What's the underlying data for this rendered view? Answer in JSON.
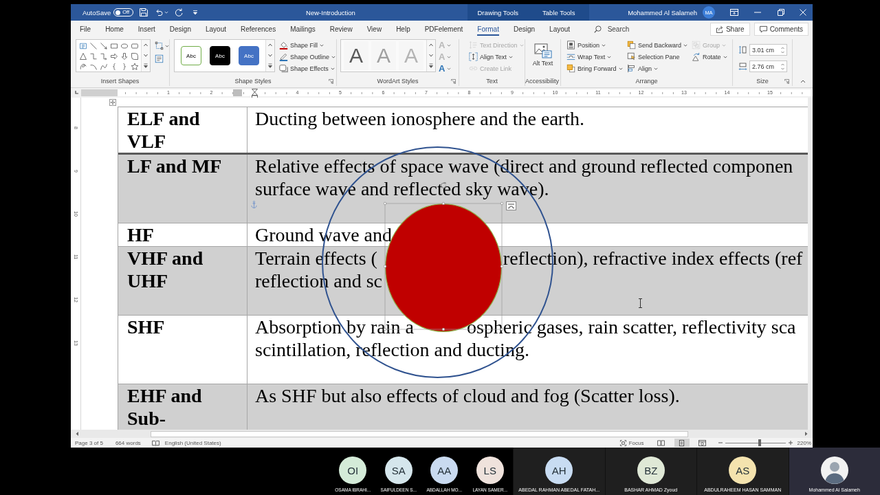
{
  "window": {
    "title": "New-Introduction",
    "autosave": {
      "label": "AutoSave",
      "state": "Off",
      "on": false
    },
    "context_groups": [
      {
        "label": "Drawing Tools"
      },
      {
        "label": "Table Tools"
      }
    ],
    "account": {
      "name": "Mohammed Al Salameh",
      "initials": "MA"
    }
  },
  "ribbon_tabs": [
    {
      "label": "File",
      "selected": false
    },
    {
      "label": "Home",
      "selected": false
    },
    {
      "label": "Insert",
      "selected": false
    },
    {
      "label": "Design",
      "selected": false
    },
    {
      "label": "Layout",
      "selected": false
    },
    {
      "label": "References",
      "selected": false
    },
    {
      "label": "Mailings",
      "selected": false
    },
    {
      "label": "Review",
      "selected": false
    },
    {
      "label": "View",
      "selected": false
    },
    {
      "label": "Help",
      "selected": false
    },
    {
      "label": "PDFelement",
      "selected": false
    },
    {
      "label": "Format",
      "selected": true
    },
    {
      "label": "Design",
      "selected": false
    },
    {
      "label": "Layout",
      "selected": false
    }
  ],
  "tell_me": {
    "placeholder": "Search"
  },
  "share": {
    "label": "Share"
  },
  "comments": {
    "label": "Comments"
  },
  "ribbon": {
    "insert_shapes": {
      "label": "Insert Shapes"
    },
    "shape_styles": {
      "label": "Shape Styles",
      "presets": [
        {
          "label": "Abc",
          "kind": "outline",
          "color": "#70ad47"
        },
        {
          "label": "Abc",
          "kind": "fill",
          "color": "#000000"
        },
        {
          "label": "Abc",
          "kind": "fill",
          "color": "#4472c4"
        }
      ],
      "commands": [
        {
          "label": "Shape Fill",
          "kind": "fill",
          "disabled": false,
          "dropdown": true
        },
        {
          "label": "Shape Outline",
          "kind": "outline",
          "disabled": false,
          "dropdown": true
        },
        {
          "label": "Shape Effects",
          "kind": "effects",
          "disabled": false,
          "dropdown": true
        }
      ]
    },
    "wordart_styles": {
      "label": "WordArt Styles",
      "presets": [
        {
          "label": "A",
          "color": "#5a5a5a"
        },
        {
          "label": "A",
          "color": "#a0a0a0"
        },
        {
          "label": "A",
          "color": "#b4b4b4"
        }
      ],
      "commands": [
        {
          "label": "A",
          "disabled": true
        },
        {
          "label": "A",
          "disabled": true
        },
        {
          "label": "A",
          "disabled": false
        }
      ]
    },
    "text": {
      "label": "Text",
      "commands": [
        {
          "label": "Text Direction",
          "kind": "direction",
          "disabled": true,
          "dropdown": true
        },
        {
          "label": "Align Text",
          "kind": "alignment",
          "disabled": false,
          "dropdown": true
        },
        {
          "label": "Create Link",
          "kind": "link",
          "disabled": true,
          "dropdown": false
        }
      ]
    },
    "accessibility": {
      "label": "Accessibility",
      "alt_text": "Alt Text"
    },
    "arrange": {
      "label": "Arrange",
      "columns": [
        [
          {
            "label": "Position",
            "kind": "position",
            "disabled": false,
            "dropdown": true
          },
          {
            "label": "Wrap Text",
            "kind": "wrap",
            "disabled": false,
            "dropdown": true
          },
          {
            "label": "Bring Forward",
            "kind": "forward",
            "disabled": false,
            "dropdown": true
          }
        ],
        [
          {
            "label": "Send Backward",
            "kind": "backward",
            "disabled": false,
            "dropdown": true
          },
          {
            "label": "Selection Pane",
            "kind": "selection",
            "disabled": false,
            "dropdown": false
          },
          {
            "label": "Align",
            "kind": "align",
            "disabled": false,
            "dropdown": true
          }
        ],
        [
          {
            "label": "Group",
            "kind": "group",
            "disabled": true,
            "dropdown": true
          },
          {
            "label": "Rotate",
            "kind": "rotate",
            "disabled": false,
            "dropdown": true
          }
        ]
      ]
    },
    "size": {
      "label": "Size",
      "fields": [
        {
          "kind": "height",
          "value": "3.01 cm"
        },
        {
          "kind": "width",
          "value": "2.76 cm"
        }
      ]
    }
  },
  "ruler": {
    "marks": [
      {
        "kind": "number",
        "label": "1"
      },
      {
        "kind": "number",
        "label": "2"
      },
      {
        "kind": "indent"
      },
      {
        "kind": "number",
        "label": "4"
      },
      {
        "kind": "number",
        "label": "5"
      },
      {
        "kind": "number",
        "label": "6"
      },
      {
        "kind": "number",
        "label": "7"
      },
      {
        "kind": "number",
        "label": "8"
      },
      {
        "kind": "number",
        "label": "9"
      },
      {
        "kind": "number",
        "label": "10"
      },
      {
        "kind": "number",
        "label": "11"
      },
      {
        "kind": "number",
        "label": "12"
      },
      {
        "kind": "number",
        "label": "13"
      },
      {
        "kind": "number",
        "label": "14"
      },
      {
        "kind": "number",
        "label": "15"
      }
    ]
  },
  "vertical_ruler": {
    "labels": [
      "8",
      "9",
      "10",
      "11",
      "12",
      "13"
    ]
  },
  "table": {
    "rows": [
      {
        "label": "ELF and VLF",
        "shaded": false,
        "lines": [
          [
            "Ducting between ionosphere and the earth."
          ]
        ]
      },
      {
        "label": "LF and MF",
        "shaded": true,
        "lines": [
          [
            "Relative effects of space wave (direct and ground reflected componen"
          ],
          [
            "surface wave and reflected sky wave)."
          ]
        ]
      },
      {
        "label": "HF",
        "shaded": false,
        "lines": [
          [
            "Ground wave and"
          ]
        ]
      },
      {
        "label": "VHF and UHF",
        "shaded": true,
        "lines": [
          [
            "Terrain effects (",
            "reflection), refractive index effects (ref"
          ],
          [
            "reflection and sc"
          ]
        ]
      },
      {
        "label": "SHF",
        "shaded": false,
        "lines": [
          [
            "Absorption by rain a",
            "ospheric gases, rain scatter, reflectivity sca"
          ],
          [
            "scintillation, reflection and ducting."
          ]
        ]
      },
      {
        "label": "EHF and Sub-",
        "shaded": true,
        "lines": [
          [
            "As SHF but also effects of cloud and fog (Scatter loss)."
          ]
        ]
      }
    ]
  },
  "status_bar": {
    "page": "Page 3 of 5",
    "words": "664 words",
    "language": "English (United States)",
    "focus": "Focus",
    "views": [
      {
        "kind": "read",
        "selected": false
      },
      {
        "kind": "print",
        "selected": true
      },
      {
        "kind": "web",
        "selected": false
      }
    ],
    "zoom": {
      "level": 0.57,
      "label": "220%"
    }
  },
  "participants": {
    "small_tiles": [
      {
        "kind": "initials",
        "initials": "OI",
        "name": "OSAMA IBRAHI...",
        "color": "#d4ebd8"
      },
      {
        "kind": "initials",
        "initials": "SA",
        "name": "SAIFULDEEN S...",
        "color": "#d5e6ec"
      },
      {
        "kind": "initials",
        "initials": "AA",
        "name": "ABDALLAH MO...",
        "color": "#c9daf0"
      },
      {
        "kind": "initials",
        "initials": "LS",
        "name": "LAYAN SAMER...",
        "color": "#efe2dc"
      }
    ],
    "tiles": [
      {
        "kind": "initials",
        "initials": "AH",
        "name": "ABEDAL RAHMAN ABEDAL FATAH...",
        "color": "#c8dcf2"
      },
      {
        "kind": "initials",
        "initials": "BZ",
        "name": "BASHAR AHMAD Zyoud",
        "color": "#dfe8d6"
      },
      {
        "kind": "initials",
        "initials": "AS",
        "name": "ABDULRAHEEM HASAN SAMMAN",
        "color": "#f4e3ae"
      },
      {
        "kind": "photo",
        "name": "Mohammed Al Salameh"
      }
    ]
  }
}
